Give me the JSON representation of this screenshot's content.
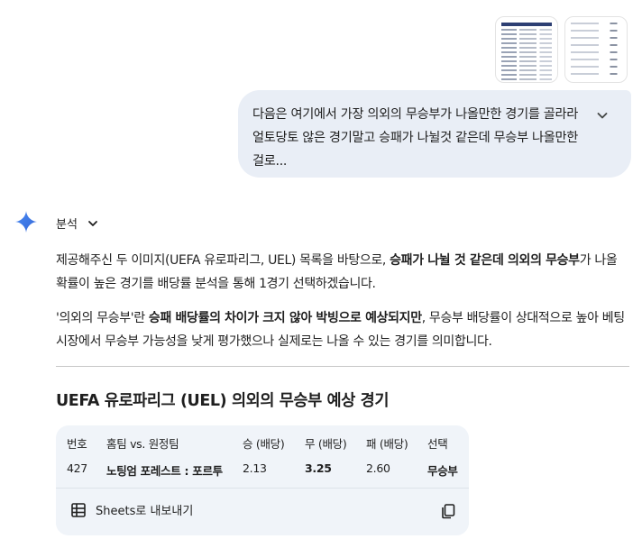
{
  "user_prompt": {
    "text": "다음은 여기에서 가장 의외의 무승부가 나올만한 경기를 골라라 얼토당토 않은 경기말고 승패가 나뉠것 같은데 무승부 나올만한 걸로..."
  },
  "response": {
    "analysis_label": "분석",
    "p1": {
      "a": "제공해주신 두 이미지(UEFA 유로파리그, UEL) 목록을 바탕으로, ",
      "b": "승패가 나뉠 것 같은데 의외의 무승부",
      "c": "가 나올 확률이 높은 경기를 배당률 분석을 통해 1경기 선택하겠습니다."
    },
    "p2": {
      "a": "'의외의 무승부'란 ",
      "b": "승패 배당률의 차이가 크지 않아 박빙으로 예상되지만",
      "c": ", 무승부 배당률이 상대적으로 높아 베팅 시장에서 무승부 가능성을 낮게 평가했으나 실제로는 나올 수 있는 경기를 의미합니다."
    },
    "section_title": "UEFA 유로파리그 (UEL) 의외의 무승부 예상 경기",
    "table": {
      "headers": [
        "번호",
        "홈팀 vs. 원정팀",
        "승 (배당)",
        "무 (배당)",
        "패 (배당)",
        "선택"
      ],
      "row": [
        "427",
        "노팅엄 포레스트 : 포르투",
        "2.13",
        "3.25",
        "2.60",
        "무승부"
      ]
    },
    "export_label": "Sheets로 내보내기"
  },
  "colors": {
    "bubble_bg": "#e9eef6",
    "card_bg": "#f0f4f9",
    "gem_blue": "#3b78e7"
  },
  "icons": [
    "chevron-down-icon",
    "gemini-spark-icon",
    "sheets-table-icon",
    "copy-icon"
  ]
}
